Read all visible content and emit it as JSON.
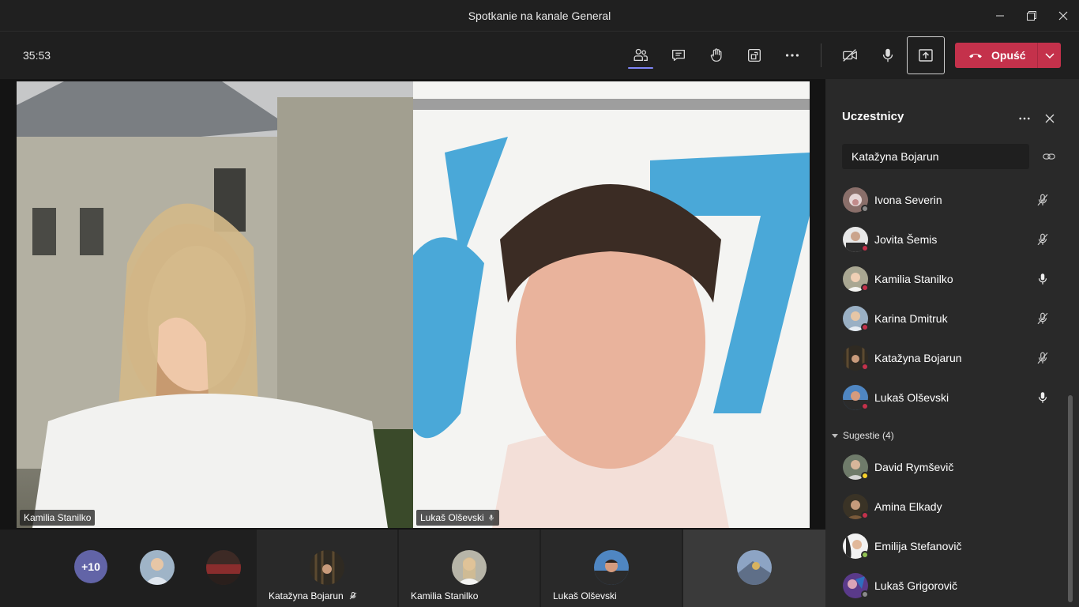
{
  "window": {
    "title": "Spotkanie na kanale General"
  },
  "toolbar": {
    "timer": "35:53",
    "leave_label": "Opuść",
    "icons": [
      "people-icon",
      "chat-icon",
      "raise-hand-icon",
      "room-icon",
      "more-icon",
      "camera-off-icon",
      "mic-icon",
      "share-icon"
    ]
  },
  "video": {
    "tiles": [
      {
        "name": "Kamilia Stanilko",
        "muted": false
      },
      {
        "name": "Lukaš Olševski",
        "muted": false
      }
    ]
  },
  "strip": {
    "overflow": "+10",
    "tiles": [
      {
        "name": "Katažyna Bojarun",
        "muted": true
      },
      {
        "name": "Kamilia Stanilko",
        "muted": false
      },
      {
        "name": "Lukaš Olševski",
        "muted": false
      }
    ]
  },
  "panel": {
    "title": "Uczestnicy",
    "search_value": "Katažyna Bojarun",
    "participants": [
      {
        "name": "Ivona Severin",
        "mic": "muted",
        "status_color": "#8a8a8a"
      },
      {
        "name": "Jovita Šemis",
        "mic": "muted",
        "status_color": "#c4314b"
      },
      {
        "name": "Kamilia Stanilko",
        "mic": "on",
        "status_color": "#c4314b"
      },
      {
        "name": "Karina Dmitruk",
        "mic": "muted",
        "status_color": "#c4314b"
      },
      {
        "name": "Katažyna Bojarun",
        "mic": "muted",
        "status_color": "#c4314b"
      },
      {
        "name": "Lukaš Olševski",
        "mic": "on",
        "status_color": "#c4314b"
      }
    ],
    "suggestions_label": "Sugestie (4)",
    "suggestions": [
      {
        "name": "David Rymševič",
        "status_color": "#f8d22a"
      },
      {
        "name": "Amina Elkady",
        "status_color": "#c4314b"
      },
      {
        "name": "Emilija Stefanovič",
        "status_color": "#92c353"
      },
      {
        "name": "Lukaš Grigorovič",
        "status_color": "#8a8a8a"
      }
    ]
  },
  "colors": {
    "accent": "#6264a7",
    "leave": "#c4314b",
    "panel_bg": "#292929",
    "app_bg": "#1f1f1f"
  }
}
